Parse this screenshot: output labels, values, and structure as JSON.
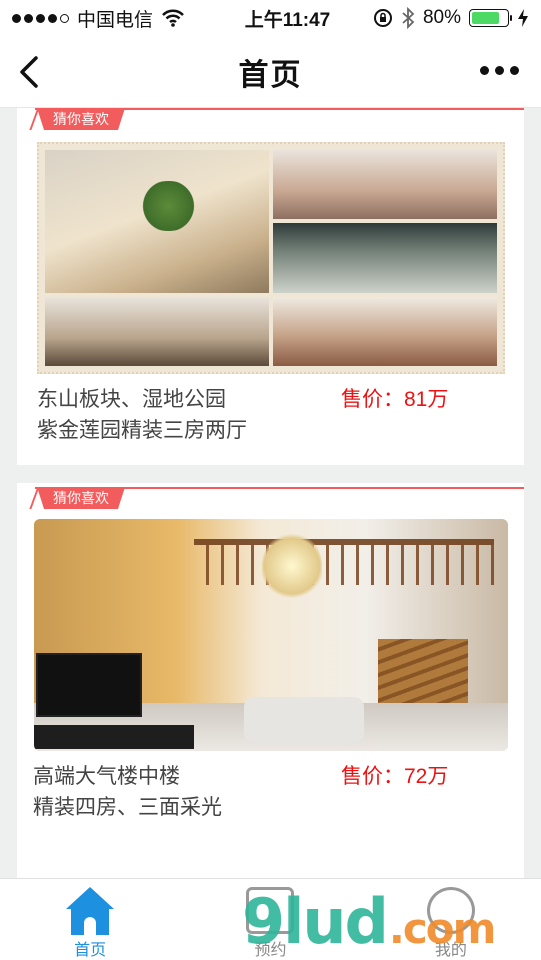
{
  "status_bar": {
    "carrier": "中国电信",
    "time": "上午11:47",
    "battery": "80%",
    "battery_level": 0.8
  },
  "nav": {
    "title": "首页"
  },
  "listings": [
    {
      "tag": "猜你喜欢",
      "line1": "东山板块、湿地公园",
      "line2": "紫金莲园精装三房两厅",
      "price": "售价：81万"
    },
    {
      "tag": "猜你喜欢",
      "line1": "高端大气楼中楼",
      "line2": "精装四房、三面采光",
      "price": "售价：72万"
    }
  ],
  "tabs": [
    {
      "label": "首页",
      "icon": "home-icon",
      "active": true
    },
    {
      "label": "预约",
      "icon": "calendar-icon",
      "active": false
    },
    {
      "label": "我的",
      "icon": "user-icon",
      "active": false
    }
  ],
  "watermark": {
    "text": "9lud",
    "suffix": ".com"
  },
  "colors": {
    "accent": "#1e90e0",
    "tag": "#f25c5c",
    "price": "#ee1111"
  }
}
